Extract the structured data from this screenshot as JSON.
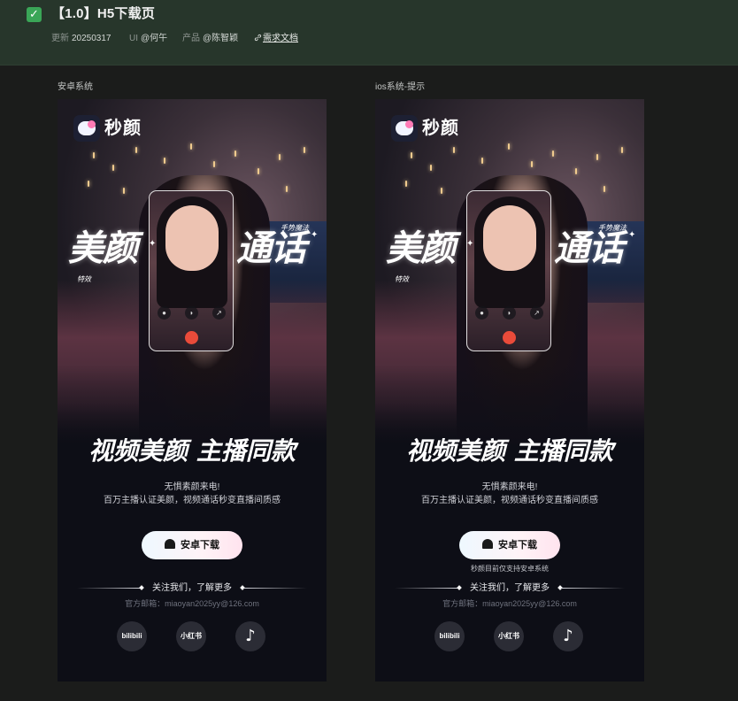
{
  "header": {
    "check_icon": "✓",
    "title": "【1.0】H5下载页",
    "updated_label": "更新",
    "updated_value": "20250317",
    "ui_label": "UI",
    "ui_value": "@何午",
    "product_label": "产品",
    "product_value": "@陈智颖",
    "doc_link": "需求文档",
    "link_icon": "link-icon"
  },
  "panels": [
    {
      "label": "安卓系统",
      "brand": "秒颜",
      "big_left": "美颜",
      "big_right": "通话",
      "tag_left": "特效",
      "tag_right": "手势魔法",
      "headline": "视频美颜 主播同款",
      "sub1": "无惧素颜来电!",
      "sub2": "百万主播认证美颜，视频通话秒变直播间质感",
      "download": "安卓下载",
      "hint": "",
      "follow": "关注我们，了解更多",
      "email": "官方邮箱：miaoyan2025yy@126.com",
      "social": [
        "bilibili",
        "小红书",
        "♪"
      ]
    },
    {
      "label": "ios系统-提示",
      "brand": "秒颜",
      "big_left": "美颜",
      "big_right": "通话",
      "tag_left": "特效",
      "tag_right": "手势魔法",
      "headline": "视频美颜 主播同款",
      "sub1": "无惧素颜来电!",
      "sub2": "百万主播认证美颜，视频通话秒变直播间质感",
      "download": "安卓下载",
      "hint": "秒颜目前仅支持安卓系统",
      "follow": "关注我们，了解更多",
      "email": "官方邮箱：miaoyan2025yy@126.com",
      "social": [
        "bilibili",
        "小红书",
        "♪"
      ]
    }
  ],
  "colors": {
    "header_bg": "#27362b",
    "page_bg": "#1b1c1b",
    "phone_bg": "#0d0e16",
    "check": "#3aa657",
    "hangup": "#ea4b3a"
  }
}
